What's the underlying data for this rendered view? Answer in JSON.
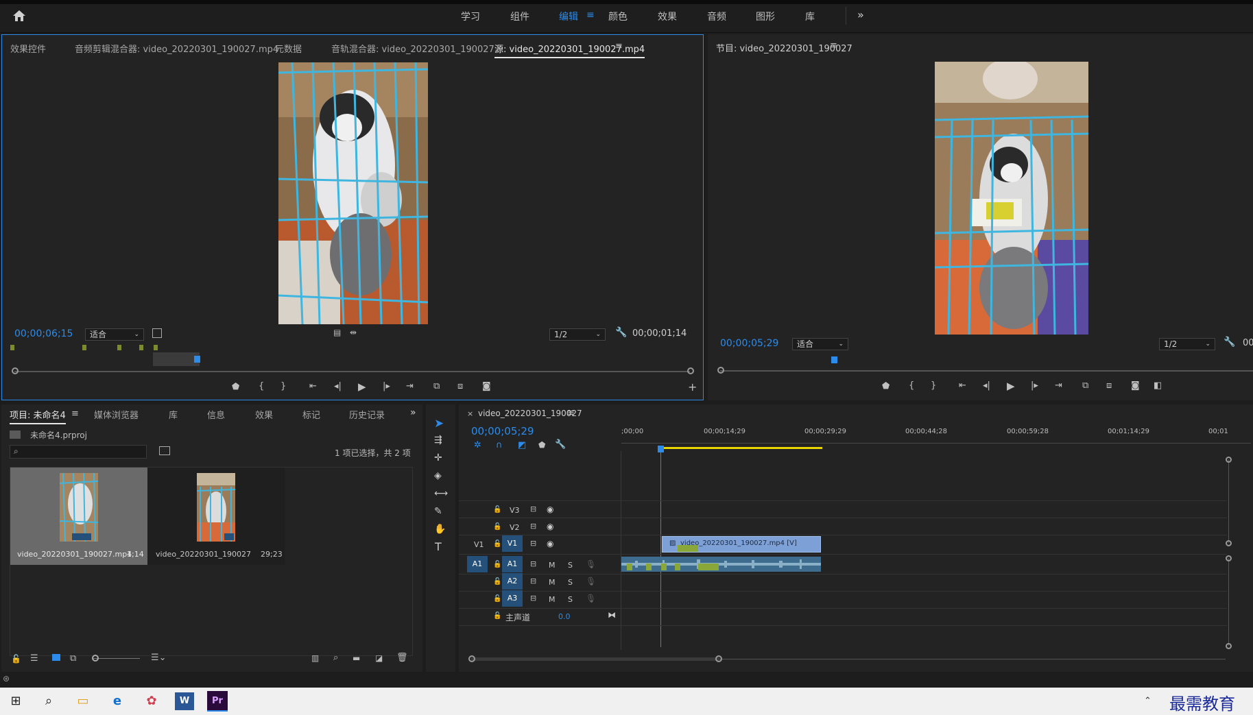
{
  "workspaces": [
    "学习",
    "组件",
    "编辑",
    "颜色",
    "效果",
    "音频",
    "图形",
    "库"
  ],
  "workspace_active": "编辑",
  "source_panel": {
    "tabs": [
      "效果控件",
      "音频剪辑混合器: video_20220301_190027.mp4",
      "元数据",
      "音轨混合器: video_20220301_190027",
      "源: video_20220301_190027.mp4"
    ],
    "timecode_in": "00;00;06;15",
    "fit": "适合",
    "resolution": "1/2",
    "duration": "00;00;01;14"
  },
  "program_panel": {
    "title": "节目: video_20220301_190027",
    "timecode": "00;00;05;29",
    "fit": "适合",
    "resolution": "1/2",
    "right_tc": "00"
  },
  "project_panel": {
    "tabs": [
      "项目: 未命名4",
      "媒体浏览器",
      "库",
      "信息",
      "效果",
      "标记",
      "历史记录"
    ],
    "project_file": "未命名4.prproj",
    "selection_info": "1 项已选择，共 2 项",
    "items": [
      {
        "name": "video_20220301_190027.mp4",
        "duration": "1;14"
      },
      {
        "name": "video_20220301_190027",
        "duration": "29;23"
      }
    ]
  },
  "timeline": {
    "sequence_tab": "video_20220301_190027",
    "timecode": "00;00;05;29",
    "ruler_labels": [
      ";00;00",
      "00;00;14;29",
      "00;00;29;29",
      "00;00;44;28",
      "00;00;59;28",
      "00;01;14;29",
      "00;01"
    ],
    "video_tracks": [
      "V3",
      "V2",
      "V1"
    ],
    "audio_tracks": [
      "A1",
      "A2",
      "A3"
    ],
    "source_v": "V1",
    "source_a": "A1",
    "master_label": "主声道",
    "master_value": "0.0",
    "video_clip": "video_20220301_190027.mp4 [V]",
    "mute": "M",
    "solo": "S"
  },
  "watermark": "最需教育",
  "colors": {
    "accent": "#2d8ceb",
    "clip_video": "#7da1d6",
    "clip_audio": "#3d6c8e",
    "panel": "#232323",
    "yellow": "#e8d400"
  }
}
